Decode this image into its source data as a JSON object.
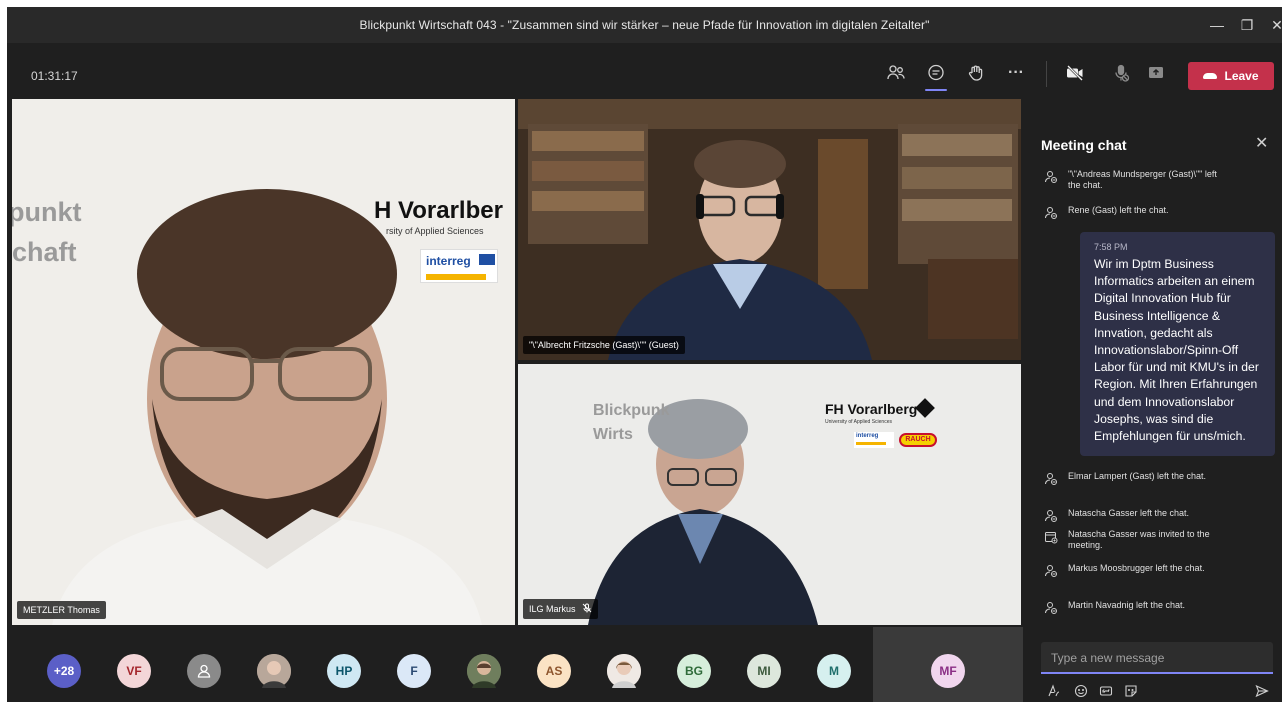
{
  "window": {
    "title": "Blickpunkt Wirtschaft 043 - \"Zusammen sind wir stärker – neue Pfade für Innovation im digitalen Zeitalter\"",
    "controls": [
      "minimize-icon",
      "restore-icon",
      "close-icon"
    ]
  },
  "toolbar": {
    "timer": "01:31:17",
    "buttons": [
      "participants-icon",
      "chat-icon",
      "reactions-icon",
      "more-icon",
      "camera-off-icon",
      "mic-off-icon",
      "share-icon"
    ],
    "leave_label": "Leave",
    "leave_color": "#c4314b",
    "accent": "#7f85f5"
  },
  "videos": [
    {
      "name": "METZLER Thomas",
      "muted": false,
      "background_text": [
        "punkt",
        "chaft"
      ],
      "logo_text": "H Vorarlber",
      "logo_sub": "rsity of Applied Sciences",
      "badge": "interreg"
    },
    {
      "name": "\"\\\"Albrecht Fritzsche (Gast)\\\"\" (Guest)",
      "muted": false
    },
    {
      "name": "ILG Markus",
      "muted": true,
      "background_text": [
        "Blickpunk",
        "Wirts"
      ],
      "logo_text": "FH Vorarlberg",
      "logo_sub": "University of Applied Sciences",
      "badge": "interreg",
      "badge2": "RAUCH"
    }
  ],
  "participants": [
    {
      "initials": "+28",
      "bg": "#5b5fc7",
      "fg": "#ffffff"
    },
    {
      "initials": "VF",
      "bg": "#f3d6d8",
      "fg": "#a4262c"
    },
    {
      "initials": "",
      "icon": "person-icon",
      "bg": "#8a8a8a",
      "fg": "#ffffff"
    },
    {
      "initials": "",
      "photo": true,
      "bg": "#b8a79a"
    },
    {
      "initials": "HP",
      "bg": "#cfe8f3",
      "fg": "#0b556a"
    },
    {
      "initials": "F",
      "bg": "#dbe8f7",
      "fg": "#2b4a73"
    },
    {
      "initials": "",
      "photo": true,
      "bg": "#7e8f6a"
    },
    {
      "initials": "AS",
      "bg": "#fbe3c4",
      "fg": "#8e562e"
    },
    {
      "initials": "",
      "photo": true,
      "bg": "#d9cbc0"
    },
    {
      "initials": "BG",
      "bg": "#d6eedb",
      "fg": "#2f6b3a"
    },
    {
      "initials": "MI",
      "bg": "#dde7dc",
      "fg": "#3d5a3d"
    },
    {
      "initials": "M",
      "bg": "#d6f0ef",
      "fg": "#1f6f6c"
    },
    {
      "initials": "MF",
      "bg": "#f1d6ee",
      "fg": "#8b2f86"
    }
  ],
  "chat": {
    "title": "Meeting chat",
    "events_top": [
      {
        "icon": "person-left-icon",
        "text": "\"\\\"Andreas Mundsperger (Gast)\\\"\" left the chat."
      },
      {
        "icon": "person-left-icon",
        "text": "Rene (Gast) left the chat."
      }
    ],
    "message": {
      "time": "7:58 PM",
      "text": "Wir im Dptm Business Informatics arbeiten an einem Digital Innovation Hub für Business Intelligence & Innvation, gedacht als Innovationslabor/Spinn-Off Labor für und mit KMU's in der Region. Mit Ihren Erfahrungen und dem Innovationslabor Josephs, was sind die Empfehlungen für uns/mich."
    },
    "events_bottom": [
      {
        "icon": "person-left-icon",
        "text": "Elmar Lampert (Gast) left the chat."
      },
      {
        "icon": "person-left-icon",
        "text": "Natascha Gasser left the chat."
      },
      {
        "icon": "calendar-invite-icon",
        "text": "Natascha Gasser was invited to the meeting."
      },
      {
        "icon": "person-left-icon",
        "text": "Markus Moosbrugger left the chat."
      },
      {
        "icon": "person-left-icon",
        "text": "Martin Navadnig left the chat."
      }
    ],
    "input_placeholder": "Type a new message",
    "compose_tools": [
      "format-icon",
      "emoji-icon",
      "gif-icon",
      "sticker-icon",
      "send-icon"
    ]
  }
}
